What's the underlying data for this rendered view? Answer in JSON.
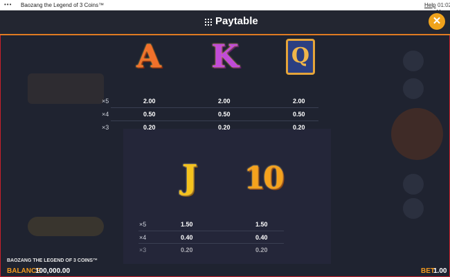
{
  "window": {
    "title": "Baozang the Legend of 3 Coins™",
    "help_label": "Help",
    "clock": "01:02",
    "menu_glyph": "•••"
  },
  "header": {
    "title": "Paytable",
    "close_glyph": "✕"
  },
  "paytable": {
    "symbols": [
      {
        "name": "A",
        "pays": [
          {
            "mult": "×5",
            "value": "2.00"
          },
          {
            "mult": "×4",
            "value": "0.50"
          },
          {
            "mult": "×3",
            "value": "0.20"
          }
        ]
      },
      {
        "name": "K",
        "pays": [
          {
            "mult": "×5",
            "value": "2.00"
          },
          {
            "mult": "×4",
            "value": "0.50"
          },
          {
            "mult": "×3",
            "value": "0.20"
          }
        ]
      },
      {
        "name": "Q",
        "pays": [
          {
            "mult": "×5",
            "value": "2.00"
          },
          {
            "mult": "×4",
            "value": "0.50"
          },
          {
            "mult": "×3",
            "value": "0.20"
          }
        ]
      },
      {
        "name": "J",
        "pays": [
          {
            "mult": "×5",
            "value": "1.50"
          },
          {
            "mult": "×4",
            "value": "0.40"
          },
          {
            "mult": "×3",
            "value": "0.20"
          }
        ]
      },
      {
        "name": "10",
        "pays": [
          {
            "mult": "×5",
            "value": "1.50"
          },
          {
            "mult": "×4",
            "value": "0.40"
          },
          {
            "mult": "×3",
            "value": "0.20"
          }
        ]
      }
    ]
  },
  "footer": {
    "game_title": "BAOZANG THE LEGEND OF 3 COINS™",
    "balance_label": "BALANCE",
    "balance_value": "100,000.00",
    "bet_label": "BET",
    "bet_value": "1.00"
  },
  "colors": {
    "accent": "#f39a1e",
    "border": "#c8202a",
    "background": "#1f2330"
  }
}
